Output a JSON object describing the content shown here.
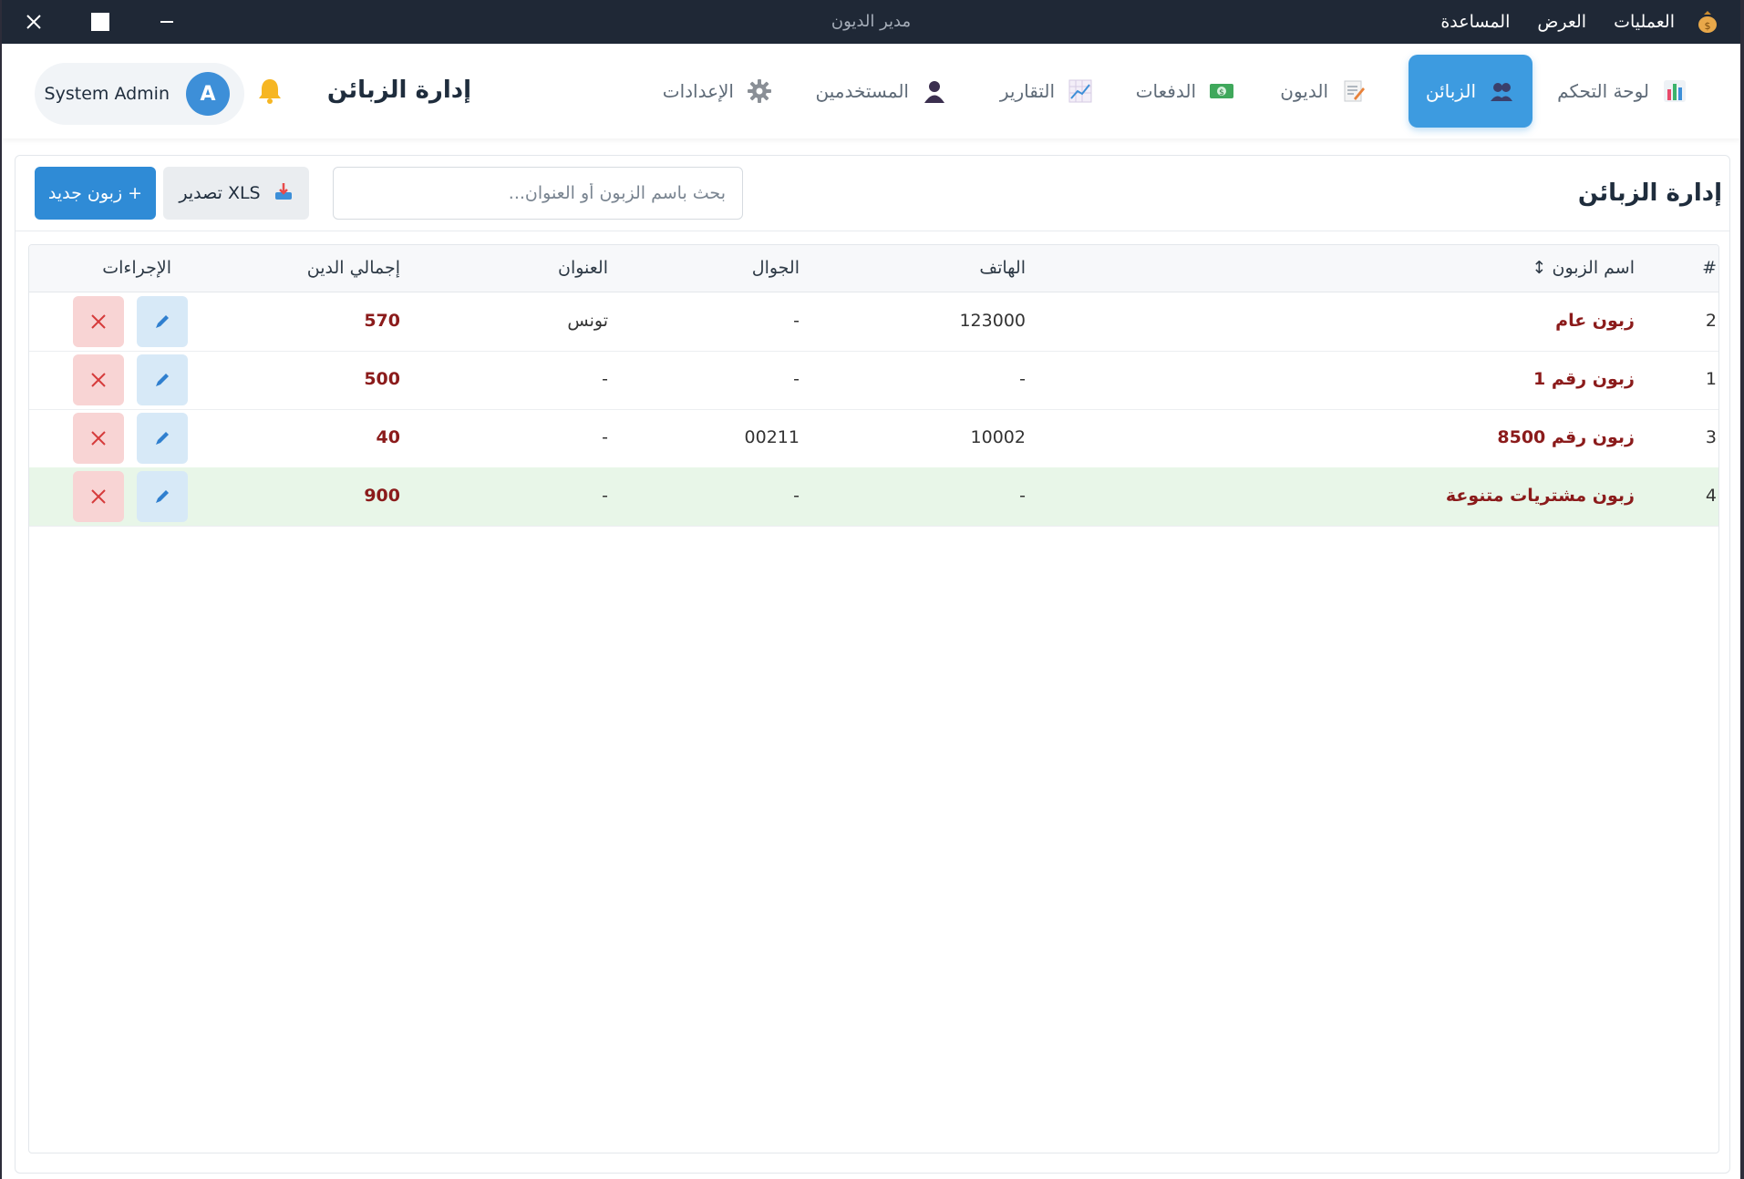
{
  "titlebar": {
    "title": "مدير الديون",
    "menu": [
      "العمليات",
      "العرض",
      "المساعدة"
    ],
    "app_icon": "money-bag-icon",
    "controls": [
      "minimize-icon",
      "maximize-icon",
      "close-icon"
    ]
  },
  "nav": {
    "items": [
      {
        "label": "لوحة التحكم",
        "icon": "bar-chart-icon"
      },
      {
        "label": "الزبائن",
        "icon": "users-icon"
      },
      {
        "label": "الديون",
        "icon": "memo-icon"
      },
      {
        "label": "الدفعات",
        "icon": "money-icon"
      },
      {
        "label": "التقارير",
        "icon": "trend-chart-icon"
      },
      {
        "label": "المستخدمين",
        "icon": "user-icon"
      },
      {
        "label": "الإعدادات",
        "icon": "gear-icon"
      }
    ],
    "active": "الزبائن",
    "page_heading": "إدارة الزبائن",
    "user_name": "System Admin",
    "avatar_letter": "A",
    "accent": "#3d9be0"
  },
  "main": {
    "title": "إدارة الزبائن",
    "search_placeholder": "بحث باسم الزبون أو العنوان...",
    "export_label": "تصدير XLS",
    "new_label": "+ زبون جديد",
    "table": {
      "headers": {
        "index": "#",
        "name": "اسم الزبون ↕",
        "phone": "الهاتف",
        "mobile": "الجوال",
        "address": "العنوان",
        "total": "إجمالي الدين",
        "actions": "الإجراءات"
      },
      "rows": [
        {
          "index": "2",
          "name": "زبون عام",
          "phone": "123000",
          "mobile": "-",
          "address": "تونس",
          "total": "570"
        },
        {
          "index": "1",
          "name": "زبون رقم 1",
          "phone": "-",
          "mobile": "-",
          "address": "-",
          "total": "500"
        },
        {
          "index": "3",
          "name": "زبون رقم 8500",
          "phone": "10002",
          "mobile": "00211",
          "address": "-",
          "total": "40"
        },
        {
          "index": "4",
          "name": "زبون مشتريات متنوعة",
          "phone": "-",
          "mobile": "-",
          "address": "-",
          "total": "900",
          "highlighted": true
        }
      ]
    }
  }
}
